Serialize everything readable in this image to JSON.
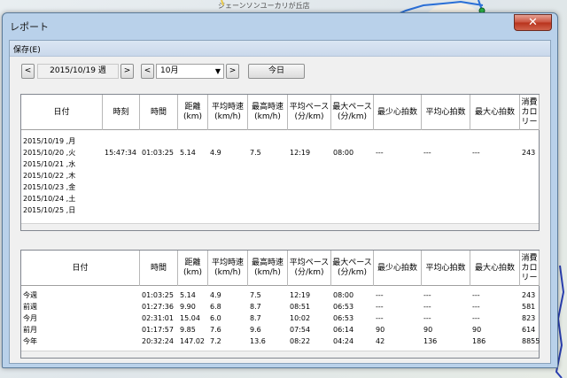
{
  "map": {
    "label": "ジェーンソンユーカリが丘店",
    "route_color": "#2a6fd6"
  },
  "window": {
    "title": "レポート",
    "close": "✕"
  },
  "menu": {
    "save": "保存(E)"
  },
  "toolbar": {
    "prev_week": "<",
    "week": "2015/10/19 週",
    "next_week": ">",
    "prev_month": "<",
    "month": "10月",
    "next_month": ">",
    "today": "今日"
  },
  "daily_table": {
    "headers": [
      "日付",
      "時刻",
      "時間",
      "距離\n(km)",
      "平均時速\n(km/h)",
      "最高時速\n(km/h)",
      "平均ペース\n(分/km)",
      "最大ペース\n(分/km)",
      "最少心拍数",
      "平均心拍数",
      "最大心拍数",
      "消費\nカロリー"
    ],
    "rows": [
      [
        "2015/10/19 ,月",
        "",
        "",
        "",
        "",
        "",
        "",
        "",
        "",
        "",
        "",
        ""
      ],
      [
        "2015/10/20 ,火",
        "15:47:34",
        "01:03:25",
        "5.14",
        "4.9",
        "7.5",
        "12:19",
        "08:00",
        "---",
        "---",
        "---",
        "243"
      ],
      [
        "2015/10/21 ,水",
        "",
        "",
        "",
        "",
        "",
        "",
        "",
        "",
        "",
        "",
        ""
      ],
      [
        "2015/10/22 ,木",
        "",
        "",
        "",
        "",
        "",
        "",
        "",
        "",
        "",
        "",
        ""
      ],
      [
        "2015/10/23 ,金",
        "",
        "",
        "",
        "",
        "",
        "",
        "",
        "",
        "",
        "",
        ""
      ],
      [
        "2015/10/24 ,土",
        "",
        "",
        "",
        "",
        "",
        "",
        "",
        "",
        "",
        "",
        ""
      ],
      [
        "2015/10/25 ,日",
        "",
        "",
        "",
        "",
        "",
        "",
        "",
        "",
        "",
        "",
        ""
      ]
    ]
  },
  "summary_table": {
    "headers": [
      "日付",
      "時間",
      "距離\n(km)",
      "平均時速\n(km/h)",
      "最高時速\n(km/h)",
      "平均ペース\n(分/km)",
      "最大ペース\n(分/km)",
      "最少心拍数",
      "平均心拍数",
      "最大心拍数",
      "消費\nカロリー"
    ],
    "rows": [
      [
        "今週",
        "01:03:25",
        "5.14",
        "4.9",
        "7.5",
        "12:19",
        "08:00",
        "---",
        "---",
        "---",
        "243"
      ],
      [
        "前週",
        "01:27:36",
        "9.90",
        "6.8",
        "8.7",
        "08:51",
        "06:53",
        "---",
        "---",
        "---",
        "581"
      ],
      [
        "今月",
        "02:31:01",
        "15.04",
        "6.0",
        "8.7",
        "10:02",
        "06:53",
        "---",
        "---",
        "---",
        "823"
      ],
      [
        "前月",
        "01:17:57",
        "9.85",
        "7.6",
        "9.6",
        "07:54",
        "06:14",
        "90",
        "90",
        "90",
        "614"
      ],
      [
        "今年",
        "20:32:24",
        "147.02",
        "7.2",
        "13.6",
        "08:22",
        "04:24",
        "42",
        "136",
        "186",
        "8855"
      ]
    ]
  }
}
